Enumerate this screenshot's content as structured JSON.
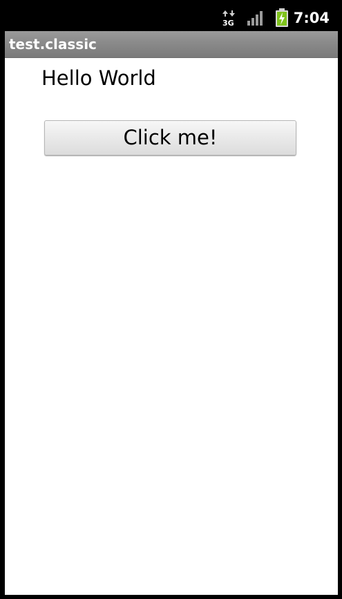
{
  "status_bar": {
    "network_type": "3G",
    "time": "7:04",
    "icons": [
      "network-3g-icon",
      "signal-strength-icon",
      "battery-charging-icon"
    ],
    "battery_color": "#7fc31c"
  },
  "app": {
    "title": "test.classic"
  },
  "content": {
    "label": "Hello World",
    "button_label": "Click me!"
  }
}
